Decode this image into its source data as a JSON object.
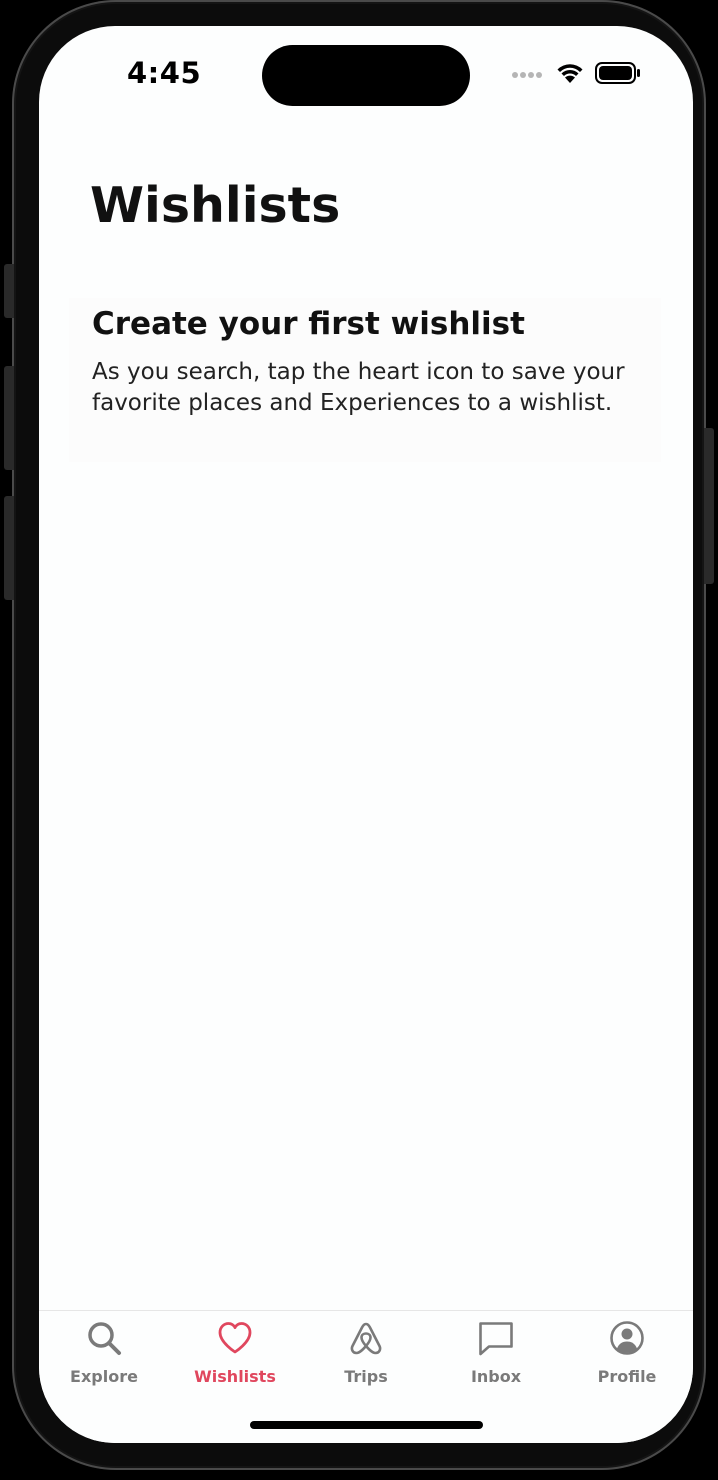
{
  "status_bar": {
    "time": "4:45",
    "signal_icon": "cellular-dots-icon",
    "wifi_icon": "wifi-icon",
    "battery_icon": "battery-icon"
  },
  "page": {
    "title": "Wishlists"
  },
  "empty_state": {
    "heading": "Create your first wishlist",
    "body": "As you search, tap the heart icon to save your favorite places and Experiences to a wishlist."
  },
  "tab_bar": {
    "active_color": "#e0475e",
    "inactive_color": "#7a7a7a",
    "tabs": [
      {
        "label": "Explore",
        "icon": "search-icon",
        "active": false
      },
      {
        "label": "Wishlists",
        "icon": "heart-icon",
        "active": true
      },
      {
        "label": "Trips",
        "icon": "airbnb-logo-icon",
        "active": false
      },
      {
        "label": "Inbox",
        "icon": "message-icon",
        "active": false
      },
      {
        "label": "Profile",
        "icon": "profile-icon",
        "active": false
      }
    ]
  }
}
